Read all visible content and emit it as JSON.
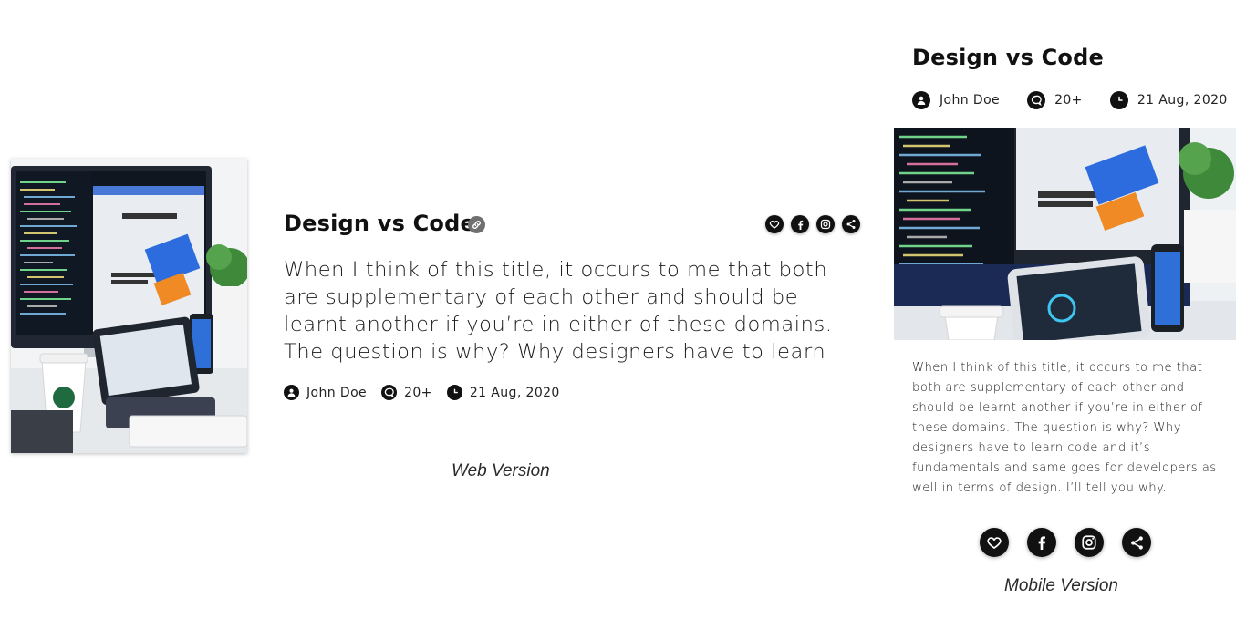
{
  "colors": {
    "text": "#111111",
    "icon_bg": "#111111",
    "link_badge": "#707070",
    "background": "#ffffff"
  },
  "web": {
    "thumbnail": {
      "icon": "desk-setup-image"
    },
    "title": "Design vs Code",
    "link_icon": "link-icon",
    "actions": [
      {
        "name": "like",
        "icon": "heart-icon"
      },
      {
        "name": "facebook",
        "icon": "facebook-icon"
      },
      {
        "name": "instagram",
        "icon": "instagram-icon"
      },
      {
        "name": "share",
        "icon": "share-icon"
      }
    ],
    "body": "When I think of this title, it occurs to me that both are supplementary of each other and should be learnt another if you’re in either of these domains. The question is why? Why designers have to learn",
    "meta": {
      "author": "John Doe",
      "comments": "20+",
      "date": "21 Aug, 2020"
    },
    "caption": "Web Version"
  },
  "mobile": {
    "title": "Design vs Code",
    "meta": {
      "author": "John Doe",
      "comments": "20+",
      "date": "21 Aug, 2020"
    },
    "thumbnail": {
      "icon": "desk-setup-image"
    },
    "body": "When I think of this title, it occurs to me that both are supplementary of each other and should be learnt another if you’re in either of these domains. The question is why? Why designers have to learn code and it’s fundamentals and same goes for developers as well in terms of design. I’ll tell you why.",
    "actions": [
      {
        "name": "like",
        "icon": "heart-icon"
      },
      {
        "name": "facebook",
        "icon": "facebook-icon"
      },
      {
        "name": "instagram",
        "icon": "instagram-icon"
      },
      {
        "name": "share",
        "icon": "share-icon"
      }
    ],
    "caption": "Mobile Version"
  }
}
